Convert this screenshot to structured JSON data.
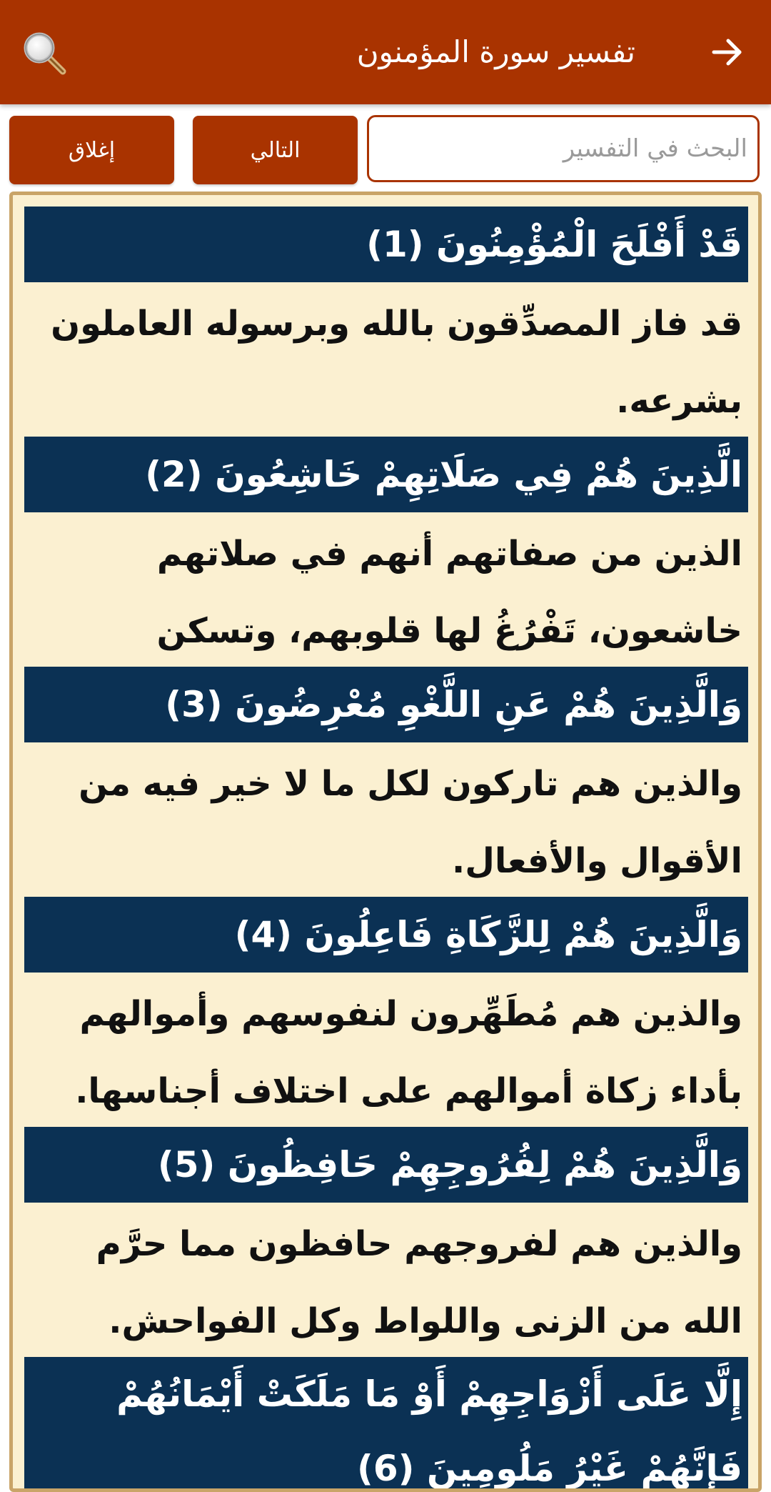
{
  "header": {
    "title": "تفسير سورة المؤمنون",
    "back_icon": "arrow-right-icon",
    "search_icon": "magnifier-icon",
    "background_color": "#a93300"
  },
  "toolbar": {
    "close_label": "إغلاق",
    "next_label": "التالي",
    "search_placeholder": "البحث في التفسير",
    "search_value": ""
  },
  "colors": {
    "verse_background": "#0b3154",
    "content_background": "#fbf0d1",
    "frame_border": "#c9a468"
  },
  "entries": [
    {
      "verse": "قَدْ أَفْلَحَ الْمُؤْمِنُونَ (1)",
      "tafsir": "قد فاز المصدِّقون بالله وبرسوله العاملون بشرعه."
    },
    {
      "verse": "الَّذِينَ هُمْ فِي صَلَاتِهِمْ خَاشِعُونَ (2)",
      "tafsir": "الذين من صفاتهم أنهم في صلاتهم خاشعون، تَفْرُغُ لها قلوبهم، وتسكن جوارحهم."
    },
    {
      "verse": "وَالَّذِينَ هُمْ عَنِ اللَّغْوِ مُعْرِضُونَ (3)",
      "tafsir": "والذين هم تاركون لكل ما لا خير فيه من الأقوال والأفعال."
    },
    {
      "verse": "وَالَّذِينَ هُمْ لِلزَّكَاةِ فَاعِلُونَ (4)",
      "tafsir": "والذين هم مُطَهِّرون لنفوسهم وأموالهم بأداء زكاة أموالهم على اختلاف أجناسها."
    },
    {
      "verse": "وَالَّذِينَ هُمْ لِفُرُوجِهِمْ حَافِظُونَ (5)",
      "tafsir": "والذين هم لفروجهم حافظون مما حرَّم الله من الزنى واللواط وكل الفواحش."
    },
    {
      "verse": "إِلَّا عَلَى أَزْوَاجِهِمْ أَوْ مَا مَلَكَتْ أَيْمَانُهُمْ فَإِنَّهُمْ غَيْرُ مَلُومِينَ (6)",
      "tafsir": ""
    }
  ]
}
